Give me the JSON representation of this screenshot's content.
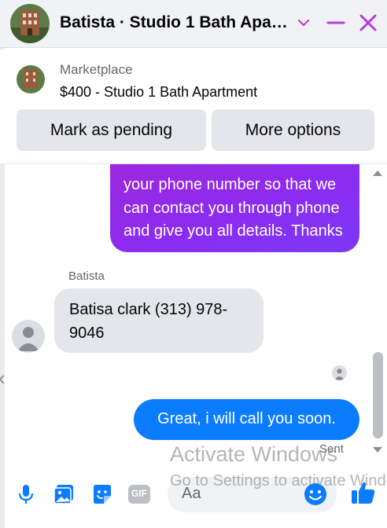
{
  "header": {
    "title": "Batista · Studio 1 Bath Apa…"
  },
  "marketplace": {
    "label": "Marketplace",
    "listing": "$400 - Studio 1 Bath Apartment",
    "buttons": {
      "pending": "Mark as pending",
      "more": "More options"
    }
  },
  "messages": {
    "outgoing_1": "your phone number so that we can contact you through phone and give you all details. Thanks",
    "sender_name": "Batista",
    "incoming_1": "Batisa clark (313) 978-9046",
    "outgoing_2": "Great, i will call you soon.",
    "status": "Sent"
  },
  "composer": {
    "placeholder": "Aa",
    "gif_label": "GIF"
  },
  "watermark": {
    "line1": "Activate Windows",
    "line2": "Go to Settings to activate Windows."
  },
  "colors": {
    "accent": "#0a7cff",
    "gradient_start": "#a225d6",
    "gradient_end": "#7b38f5",
    "close_icon": "#b53cdc"
  },
  "icons": [
    "chevron-down-icon",
    "minimize-icon",
    "close-icon",
    "microphone-icon",
    "photo-icon",
    "sticker-icon",
    "gif-icon",
    "emoji-icon",
    "thumbs-up-icon"
  ]
}
